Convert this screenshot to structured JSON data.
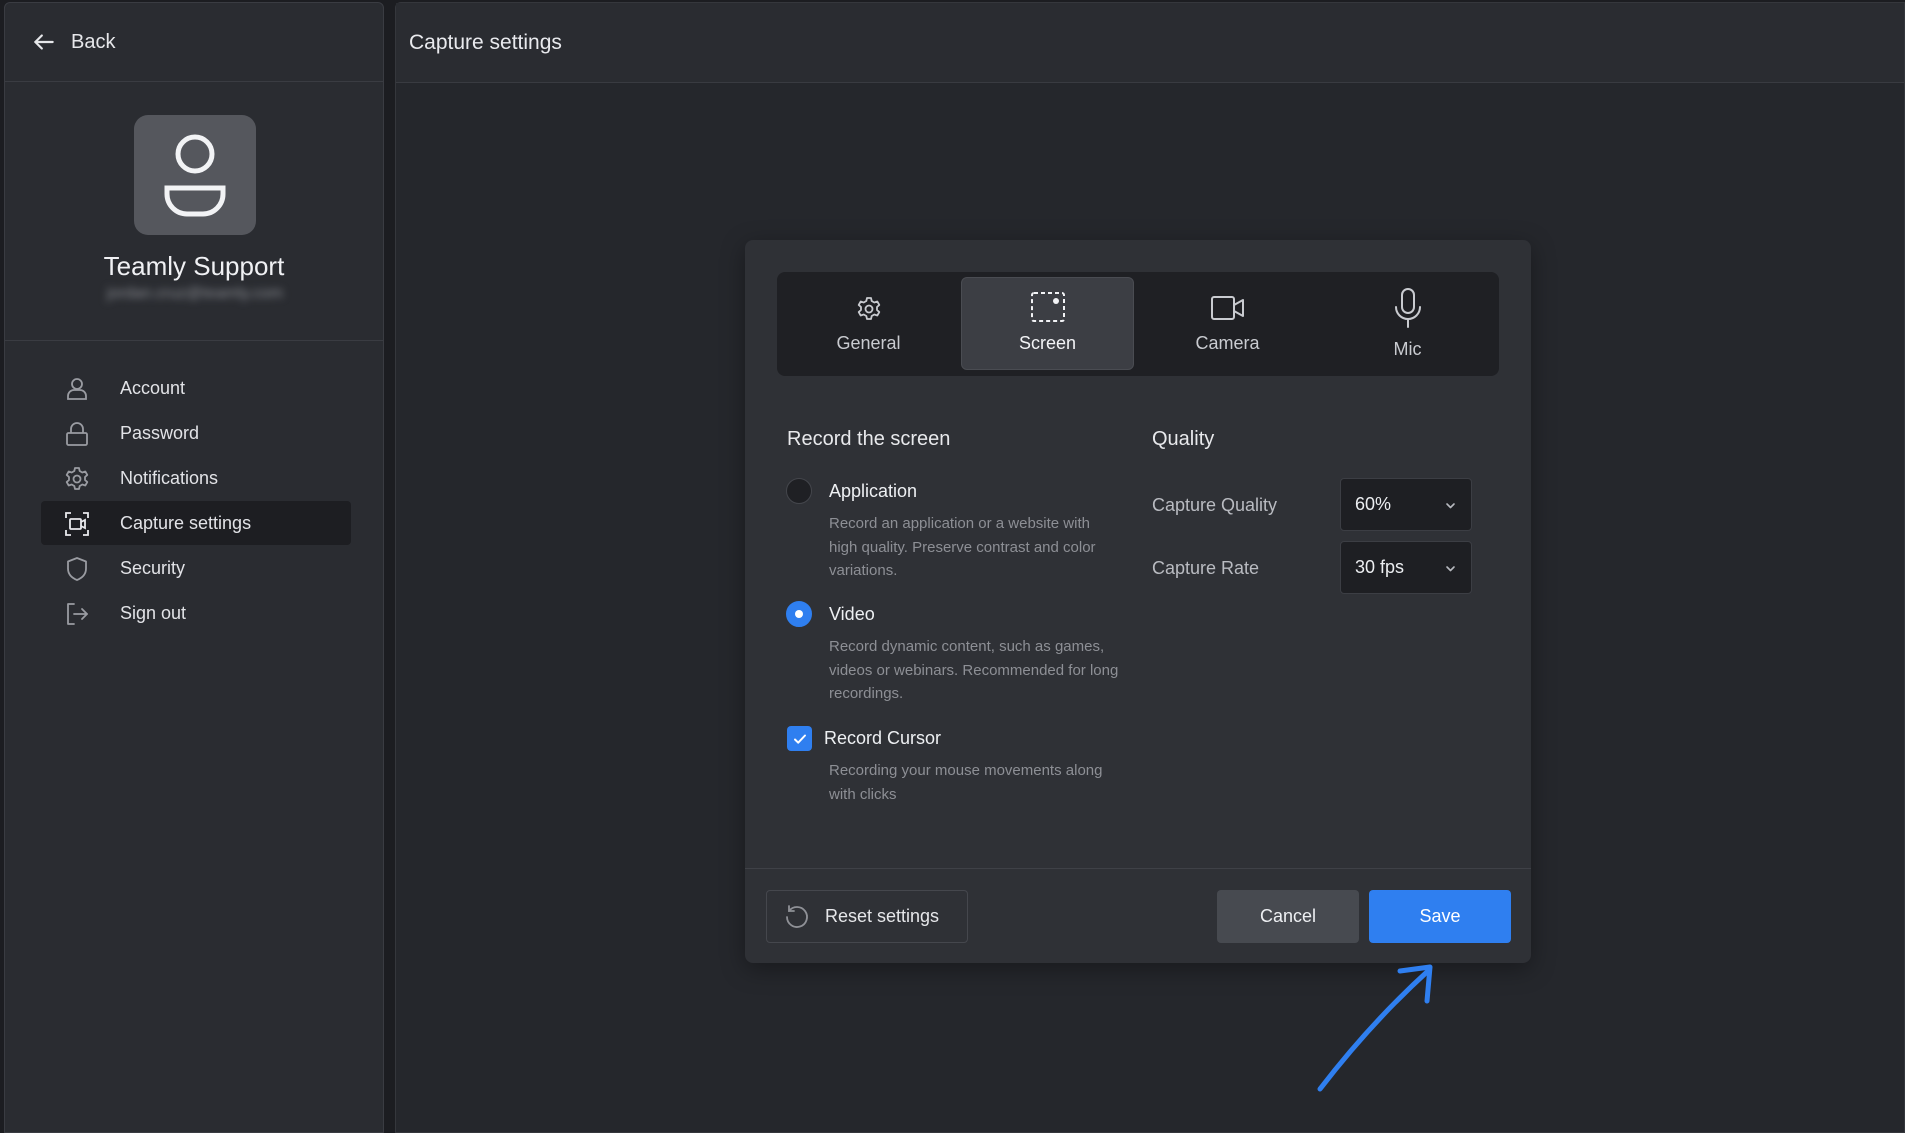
{
  "sidebar": {
    "back_label": "Back",
    "profile": {
      "name": "Teamly Support",
      "email": "jordan.cruz@teamly.com"
    },
    "nav": [
      {
        "label": "Account",
        "icon": "user-icon"
      },
      {
        "label": "Password",
        "icon": "lock-icon"
      },
      {
        "label": "Notifications",
        "icon": "gear-icon"
      },
      {
        "label": "Capture settings",
        "icon": "capture-icon",
        "active": true
      },
      {
        "label": "Security",
        "icon": "shield-icon"
      },
      {
        "label": "Sign out",
        "icon": "sign-out-icon"
      }
    ]
  },
  "main": {
    "title": "Capture settings"
  },
  "dialog": {
    "tabs": [
      {
        "label": "General",
        "icon": "gear-icon"
      },
      {
        "label": "Screen",
        "icon": "screen-capture-icon",
        "active": true
      },
      {
        "label": "Camera",
        "icon": "camera-icon"
      },
      {
        "label": "Mic",
        "icon": "microphone-icon"
      }
    ],
    "record": {
      "title": "Record the screen",
      "application": {
        "label": "Application",
        "desc": "Record an application or a website with high quality. Preserve contrast and color variations.",
        "selected": false
      },
      "video": {
        "label": "Video",
        "desc": "Record dynamic content, such as games, videos or webinars. Recommended for long recordings.",
        "selected": true
      },
      "cursor": {
        "label": "Record Cursor",
        "desc": "Recording your mouse movements along with clicks",
        "checked": true
      }
    },
    "quality": {
      "title": "Quality",
      "capture_quality": {
        "label": "Capture Quality",
        "value": "60%"
      },
      "capture_rate": {
        "label": "Capture Rate",
        "value": "30 fps"
      }
    },
    "buttons": {
      "reset": "Reset settings",
      "cancel": "Cancel",
      "save": "Save"
    }
  },
  "colors": {
    "accent": "#2f7ff0",
    "background": "#1c1d21",
    "panel": "#2f3136"
  }
}
